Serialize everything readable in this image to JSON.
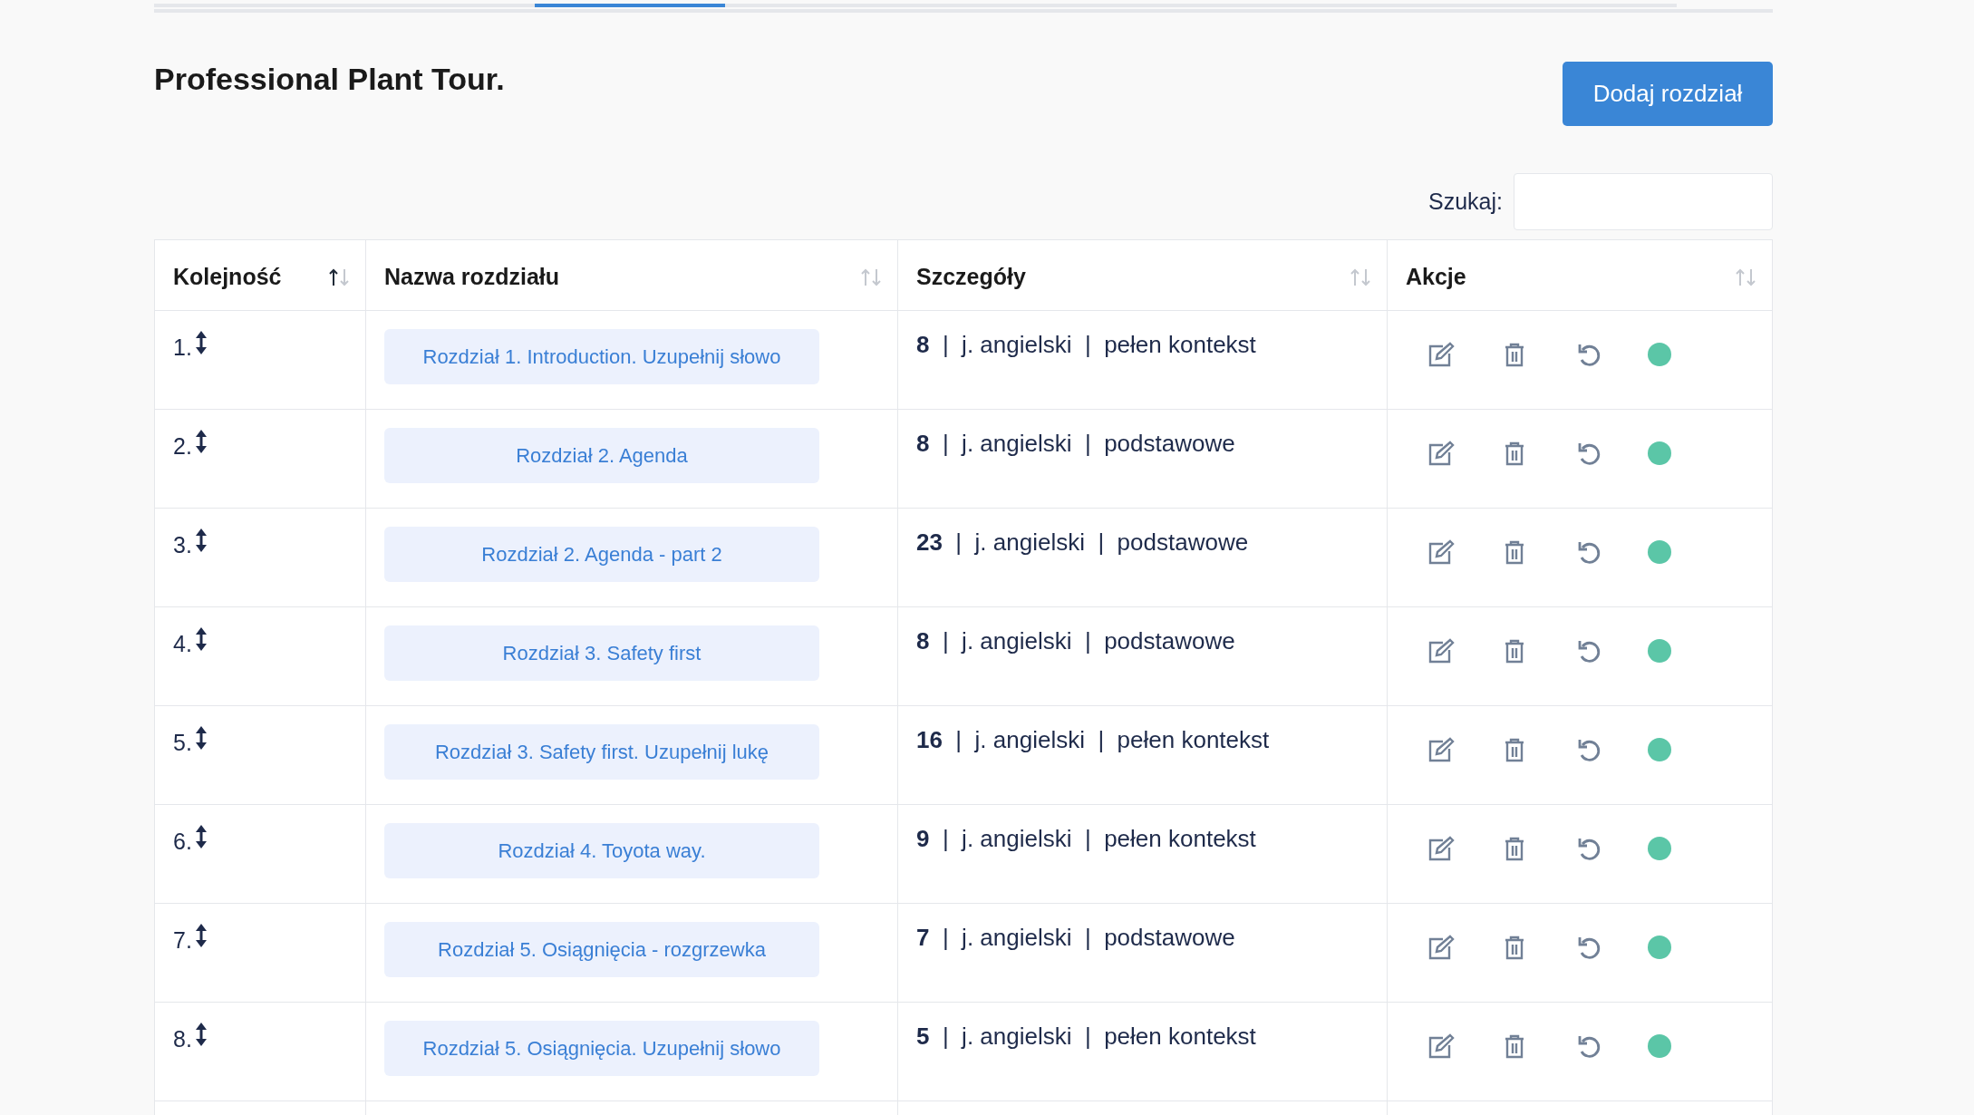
{
  "tabs_bar": [
    {
      "selected": false
    },
    {
      "selected": false
    },
    {
      "selected": true
    },
    {
      "selected": false
    },
    {
      "selected": false
    },
    {
      "selected": false
    },
    {
      "selected": false
    },
    {
      "selected": false
    }
  ],
  "title": "Professional Plant Tour.",
  "add_button": "Dodaj rozdział",
  "search": {
    "label": "Szukaj:"
  },
  "table": {
    "columns": [
      {
        "label": "Kolejność",
        "sorted_ascending": true
      },
      {
        "label": "Nazwa rozdziału",
        "sorted_ascending": false
      },
      {
        "label": "Szczegóły",
        "sorted_ascending": false
      },
      {
        "label": "Akcje",
        "sorted_ascending": false
      }
    ],
    "rows": [
      {
        "order": "1.",
        "name": "Rozdział 1. Introduction. Uzupełnij słowo",
        "details": "**8**  |  j. angielski  |  pełen kontekst",
        "active": true
      },
      {
        "order": "2.",
        "name": "Rozdział 2. Agenda",
        "details": "**8**  |  j. angielski  |  podstawowe",
        "active": true
      },
      {
        "order": "3.",
        "name": "Rozdział 2. Agenda - part 2",
        "details": "**23**  |  j. angielski  |  podstawowe",
        "active": true
      },
      {
        "order": "4.",
        "name": "Rozdział 3. Safety first",
        "details": "**8**  |  j. angielski  |  podstawowe",
        "active": true
      },
      {
        "order": "5.",
        "name": "Rozdział 3. Safety first. Uzupełnij lukę",
        "details": "**16**  |  j. angielski  |  pełen kontekst",
        "active": true
      },
      {
        "order": "6.",
        "name": "Rozdział 4. Toyota way.",
        "details": "**9**  |  j. angielski  |  pełen kontekst",
        "active": true
      },
      {
        "order": "7.",
        "name": "Rozdział 5. Osiągnięcia - rozgrzewka",
        "details": "**7**  |  j. angielski  |  podstawowe",
        "active": true
      },
      {
        "order": "8.",
        "name": "Rozdział 5. Osiągnięcia. Uzupełnij słowo",
        "details": "**5**  |  j. angielski  |  pełen kontekst",
        "active": true
      }
    ]
  }
}
